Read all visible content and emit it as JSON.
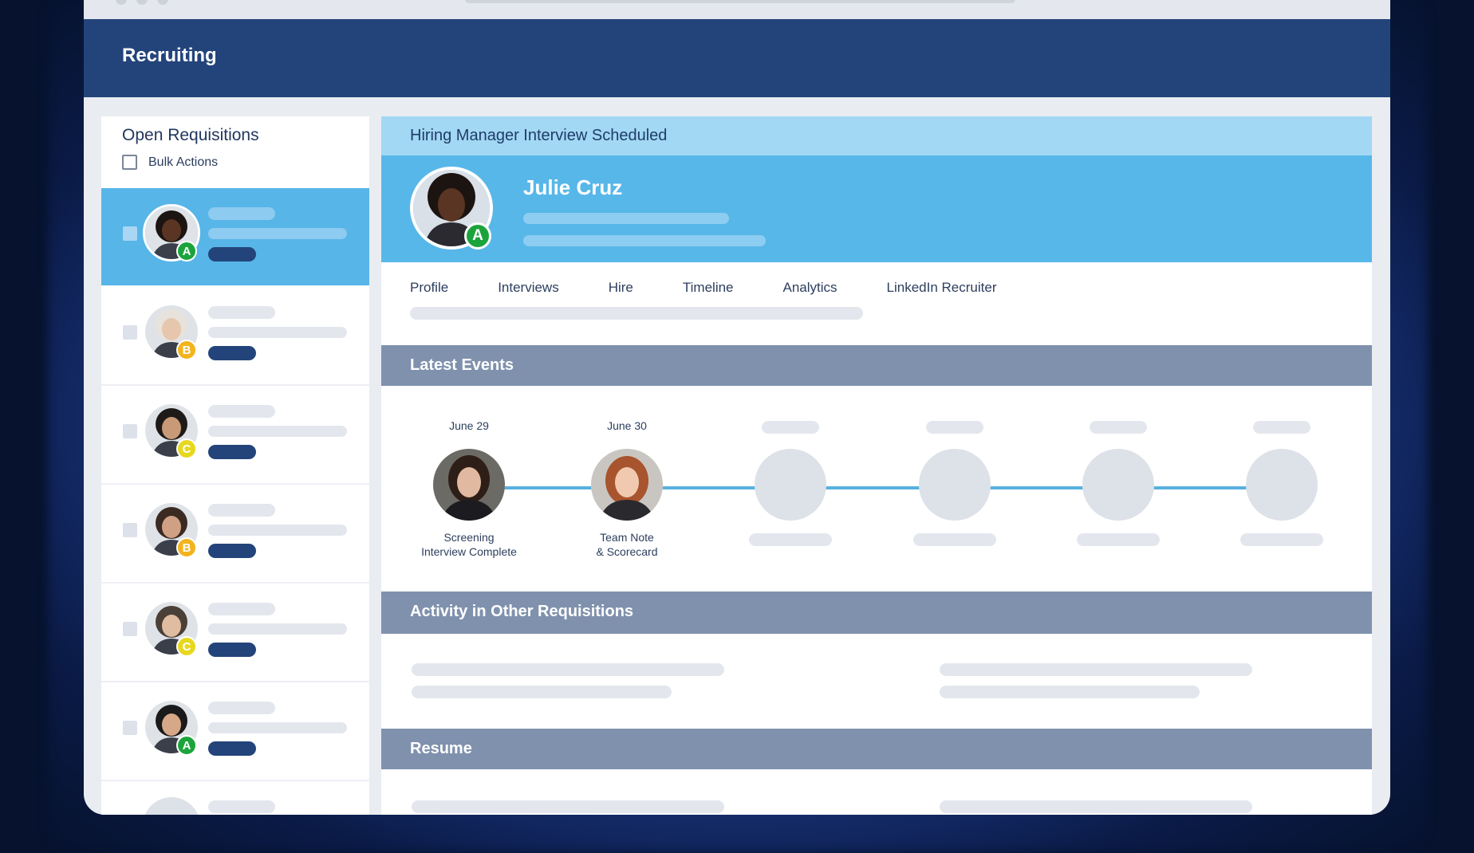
{
  "app": {
    "title": "Recruiting"
  },
  "requisitions": {
    "title": "Open Requisitions",
    "bulk_actions_label": "Bulk Actions",
    "items": [
      {
        "grade": "A",
        "grade_color": "#1ca43c",
        "selected": true
      },
      {
        "grade": "B",
        "grade_color": "#f2b31c",
        "selected": false
      },
      {
        "grade": "C",
        "grade_color": "#e7d81f",
        "selected": false
      },
      {
        "grade": "B",
        "grade_color": "#f2b31c",
        "selected": false
      },
      {
        "grade": "C",
        "grade_color": "#e7d81f",
        "selected": false
      },
      {
        "grade": "A",
        "grade_color": "#1ca43c",
        "selected": false
      }
    ]
  },
  "candidate": {
    "status": "Hiring Manager Interview Scheduled",
    "name": "Julie Cruz",
    "grade": "A"
  },
  "tabs": [
    "Profile",
    "Interviews",
    "Hire",
    "Timeline",
    "Analytics",
    "LinkedIn Recruiter"
  ],
  "sections": {
    "latest_events": "Latest Events",
    "activity": "Activity in Other Requisitions",
    "resume": "Resume"
  },
  "events": [
    {
      "date": "June 29",
      "label_line1": "Screening",
      "label_line2": "Interview Complete"
    },
    {
      "date": "June 30",
      "label_line1": "Team Note",
      "label_line2": "& Scorecard"
    }
  ],
  "colors": {
    "header": "#23447a",
    "selected_row": "#57b5e8",
    "status_bar": "#a2d8f3",
    "hero": "#58b7e9",
    "section_header": "#7f91ad",
    "grade_a": "#1ca43c",
    "grade_b": "#f2b31c",
    "grade_c": "#e7d81f"
  },
  "icons": [
    "checkbox-icon",
    "avatar-photo",
    "grade-badge"
  ]
}
